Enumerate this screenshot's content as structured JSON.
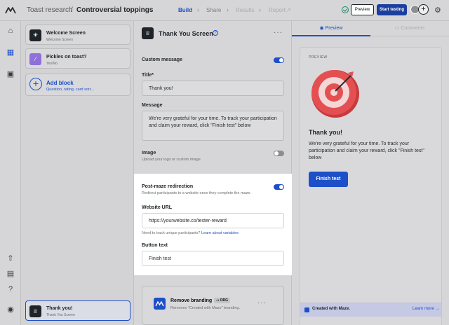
{
  "header": {
    "project": "Toast research",
    "separator": "/",
    "title": "Controversial toppings",
    "steps": [
      "Build",
      "Share",
      "Results",
      "Report"
    ],
    "preview_label": "Preview",
    "start_label": "Start testing"
  },
  "blocks": [
    {
      "title": "Welcome Screen",
      "subtitle": "Welcome Screen"
    },
    {
      "title": "Pickles on toast?",
      "subtitle": "Yes/No"
    }
  ],
  "add_block": {
    "title": "Add block",
    "subtitle": "Question, rating, card sort..."
  },
  "final_block": {
    "title": "Thank you!",
    "subtitle": "Thank You Screen"
  },
  "editor": {
    "title": "Thank You Screen",
    "custom_message_label": "Custom message",
    "title_label": "Title*",
    "title_value": "Thank you!",
    "message_label": "Message",
    "message_value": "We're very grateful for your time. To track your participation and claim your reward, click \"Finish test\" below",
    "image_label": "Image",
    "image_sub": "Upload your logo or custom image",
    "redirect_label": "Post-maze redirection",
    "redirect_sub": "Redirect participants to a website once they complete the maze.",
    "url_label": "Website URL",
    "url_value": "https://yourwebsite.co/tester-reward",
    "url_hint": "Need to track unique participants?",
    "url_hint_link": "Learn about variables",
    "button_label": "Button text",
    "button_value": "Finish test",
    "branding_title": "Remove branding",
    "branding_badge": "ORG",
    "branding_sub": "Removes \"Created with Maze\" branding."
  },
  "preview": {
    "tab_preview": "Preview",
    "tab_comments": "Comments",
    "label": "PREVIEW",
    "title": "Thank you!",
    "message": "We're very grateful for your time. To track your participation and claim your reward, click \"Finish test\" below",
    "button": "Finish test",
    "footer_text": "Created with Maze.",
    "footer_link": "Learn more →"
  }
}
